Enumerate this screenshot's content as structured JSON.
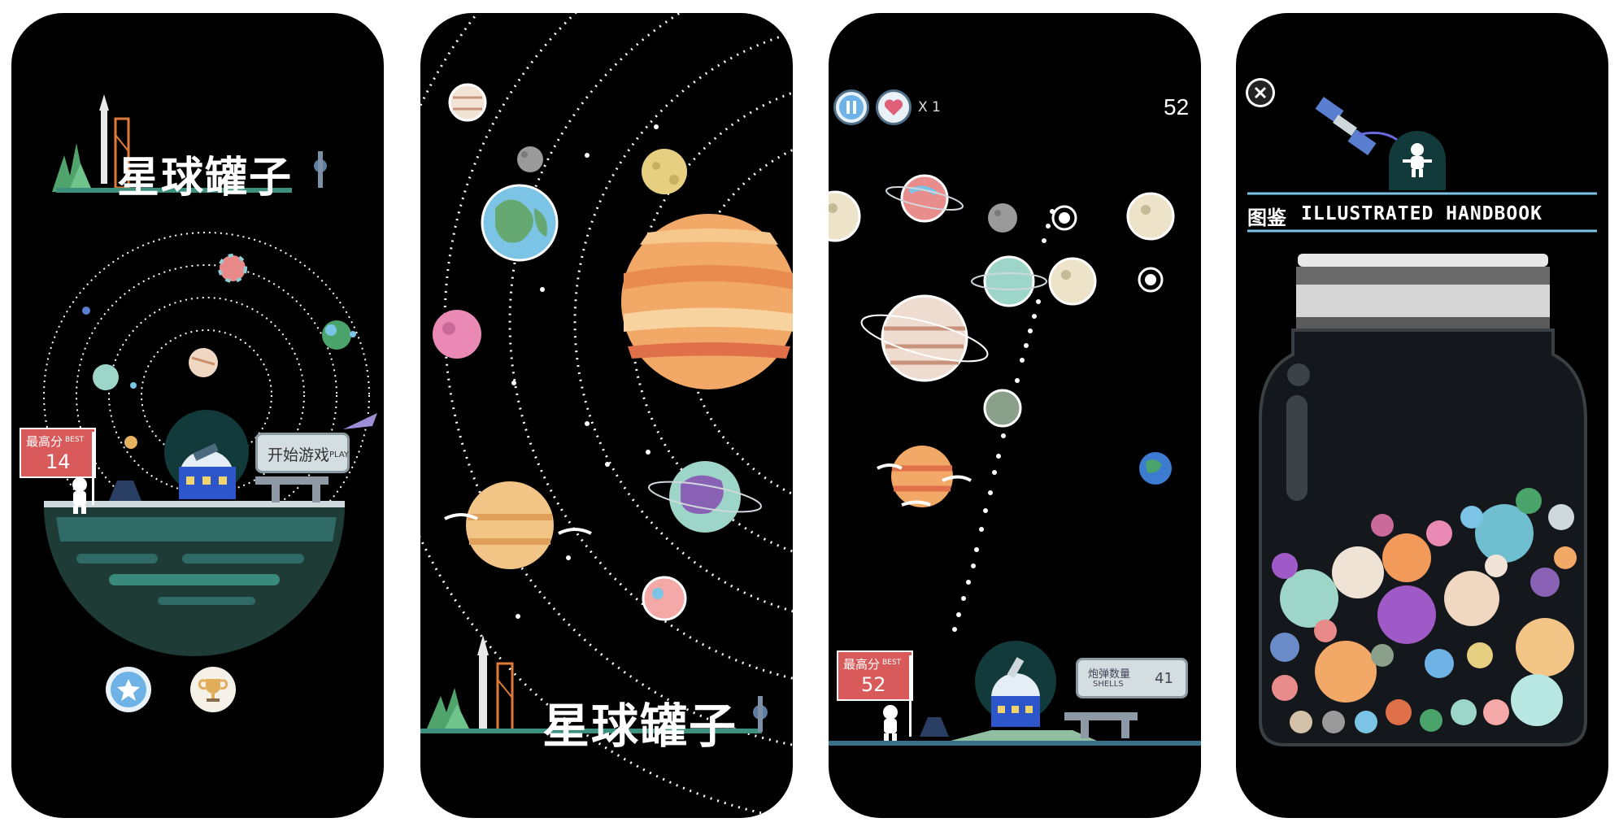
{
  "screen1": {
    "title": "星球罐子",
    "best_label": "最高分",
    "best_label_en": "BEST",
    "best_score": "14",
    "play_label": "开始游戏",
    "play_label_en": "PLAY",
    "icons": [
      "star-icon",
      "trophy-icon"
    ]
  },
  "screen2": {
    "title": "星球罐子"
  },
  "screen3": {
    "lives_multiplier": "X 1",
    "score": "52",
    "best_label": "最高分",
    "best_label_en": "BEST",
    "best_score": "52",
    "shells_label": "炮弹数量",
    "shells_label_en": "SHELLS",
    "shells_count": "41",
    "icons": [
      "pause-icon",
      "heart-icon"
    ]
  },
  "screen4": {
    "handbook_cn": "图鉴",
    "handbook_en": "ILLUSTRATED HANDBOOK",
    "icons": [
      "close-icon"
    ]
  },
  "colors": {
    "background": "#000000",
    "sign_red": "#d85a5a",
    "ground_teal": "#2f6a66",
    "accent_blue": "#7cc4e6"
  }
}
